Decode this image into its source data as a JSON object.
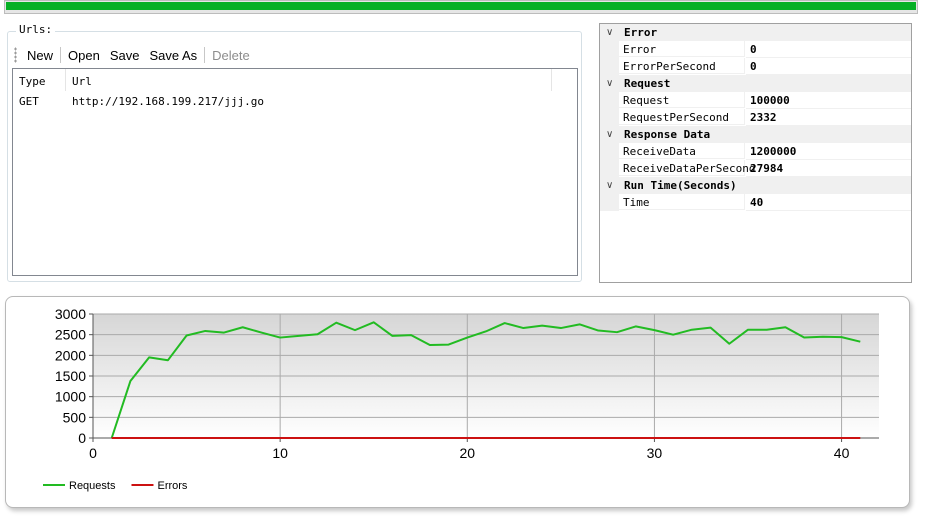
{
  "progress": {
    "fraction": 1.0,
    "color": "#06b025"
  },
  "urls_group": {
    "legend": "Urls:",
    "toolbar": {
      "new_label": "New",
      "open_label": "Open",
      "save_label": "Save",
      "save_as_label": "Save As",
      "delete_label": "Delete"
    },
    "list": {
      "columns": [
        "Type",
        "Url"
      ],
      "rows": [
        {
          "type": "GET",
          "url": "http://192.168.199.217/jjj.go"
        }
      ]
    }
  },
  "properties": {
    "categories": [
      {
        "name": "Error",
        "items": [
          {
            "name": "Error",
            "value": "0"
          },
          {
            "name": "ErrorPerSecond",
            "value": "0"
          }
        ]
      },
      {
        "name": "Request",
        "items": [
          {
            "name": "Request",
            "value": "100000"
          },
          {
            "name": "RequestPerSecond",
            "value": "2332"
          }
        ]
      },
      {
        "name": "Response Data",
        "items": [
          {
            "name": "ReceiveData",
            "value": "1200000"
          },
          {
            "name": "ReceiveDataPerSecond",
            "value": "27984"
          }
        ]
      },
      {
        "name": "Run Time(Seconds)",
        "items": [
          {
            "name": "Time",
            "value": "40"
          }
        ]
      }
    ]
  },
  "chart_data": {
    "type": "line",
    "title": "",
    "xlabel": "",
    "ylabel": "",
    "xlim": [
      0,
      42
    ],
    "ylim": [
      0,
      3000
    ],
    "x_ticks": [
      0,
      10,
      20,
      30,
      40
    ],
    "y_ticks": [
      0,
      500,
      1000,
      1500,
      2000,
      2500,
      3000
    ],
    "grid": true,
    "legend_position": "bottom-left",
    "series": [
      {
        "name": "Requests",
        "color": "#22bb22",
        "x": [
          1,
          2,
          3,
          4,
          5,
          6,
          7,
          8,
          9,
          10,
          11,
          12,
          13,
          14,
          15,
          16,
          17,
          18,
          19,
          20,
          21,
          22,
          23,
          24,
          25,
          26,
          27,
          28,
          29,
          30,
          31,
          32,
          33,
          34,
          35,
          36,
          37,
          38,
          39,
          40,
          41
        ],
        "values": [
          0,
          1380,
          1950,
          1880,
          2480,
          2590,
          2550,
          2680,
          2550,
          2430,
          2470,
          2510,
          2790,
          2610,
          2800,
          2470,
          2490,
          2250,
          2260,
          2430,
          2580,
          2780,
          2660,
          2720,
          2660,
          2750,
          2600,
          2560,
          2700,
          2610,
          2500,
          2620,
          2670,
          2280,
          2620,
          2620,
          2680,
          2430,
          2450,
          2440,
          2330
        ]
      },
      {
        "name": "Errors",
        "color": "#cc1111",
        "x": [
          1,
          41
        ],
        "values": [
          0,
          0
        ]
      }
    ]
  }
}
